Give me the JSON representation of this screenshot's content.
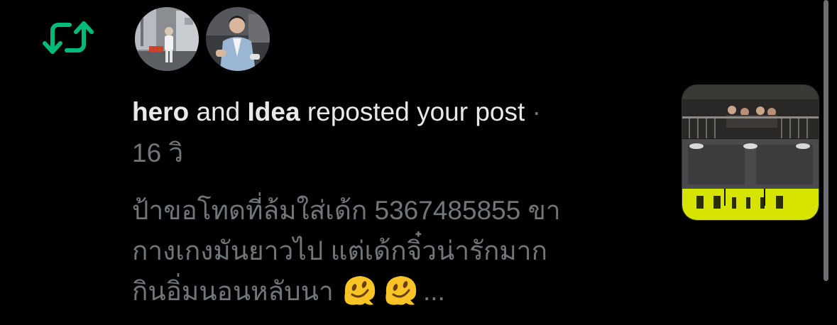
{
  "notification": {
    "type_icon": "repost-icon",
    "users": [
      {
        "name": "hero",
        "avatar_icon": "avatar-photo-hero"
      },
      {
        "name": "Idea",
        "avatar_icon": "avatar-photo-idea"
      }
    ],
    "connector": "and",
    "action": "reposted your post",
    "separator": "·",
    "timestamp": "16 วิ",
    "post_text_line1": "ป้าขอโทดที่ล้มใส่เด้ก 5367485855 ขา",
    "post_text_line2": "กางเกงมันยาวไป แต่เด้กจิ๋วน่ารักมาก",
    "post_text_line3": "กินอิ่มนอนหลับนา",
    "post_text_emojis": [
      "melting-face-emoji",
      "melting-face-emoji"
    ],
    "ellipsis": "...",
    "thumbnail": "post-image-thumbnail"
  },
  "colors": {
    "background": "#000000",
    "text_primary": "#e7e9ea",
    "text_secondary": "#71767b",
    "repost_green": "#00ba7c",
    "emoji_yellow": "#f7c325"
  }
}
